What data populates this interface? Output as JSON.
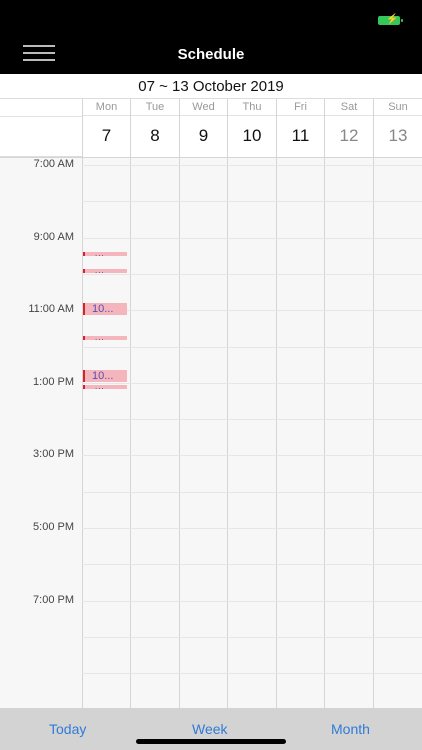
{
  "status": {
    "battery_icon": "battery-charging-icon",
    "battery_color": "#35c759"
  },
  "header": {
    "title": "Schedule",
    "menu_icon": "hamburger-menu-icon"
  },
  "week": {
    "range": "07 ~ 13 October 2019",
    "days": [
      {
        "name": "Mon",
        "date": "7",
        "weekend": false
      },
      {
        "name": "Tue",
        "date": "8",
        "weekend": false
      },
      {
        "name": "Wed",
        "date": "9",
        "weekend": false
      },
      {
        "name": "Thu",
        "date": "10",
        "weekend": false
      },
      {
        "name": "Fri",
        "date": "11",
        "weekend": false
      },
      {
        "name": "Sat",
        "date": "12",
        "weekend": true
      },
      {
        "name": "Sun",
        "date": "13",
        "weekend": true
      }
    ]
  },
  "time_labels": [
    "7:00 AM",
    "9:00 AM",
    "11:00 AM",
    "1:00 PM",
    "3:00 PM",
    "5:00 PM",
    "7:00 PM"
  ],
  "events": [
    {
      "label": "...",
      "style": "thin"
    },
    {
      "label": "...",
      "style": "thin"
    },
    {
      "label": "10...",
      "style": "big"
    },
    {
      "label": "...",
      "style": "thin"
    },
    {
      "label": "10...",
      "style": "big"
    },
    {
      "label": "...",
      "style": "thin"
    }
  ],
  "colors": {
    "event_fill": "#f4b6bc",
    "event_border": "#d0242f",
    "accent": "#2f7bd7"
  },
  "tabs": {
    "today": "Today",
    "week": "Week",
    "month": "Month"
  }
}
